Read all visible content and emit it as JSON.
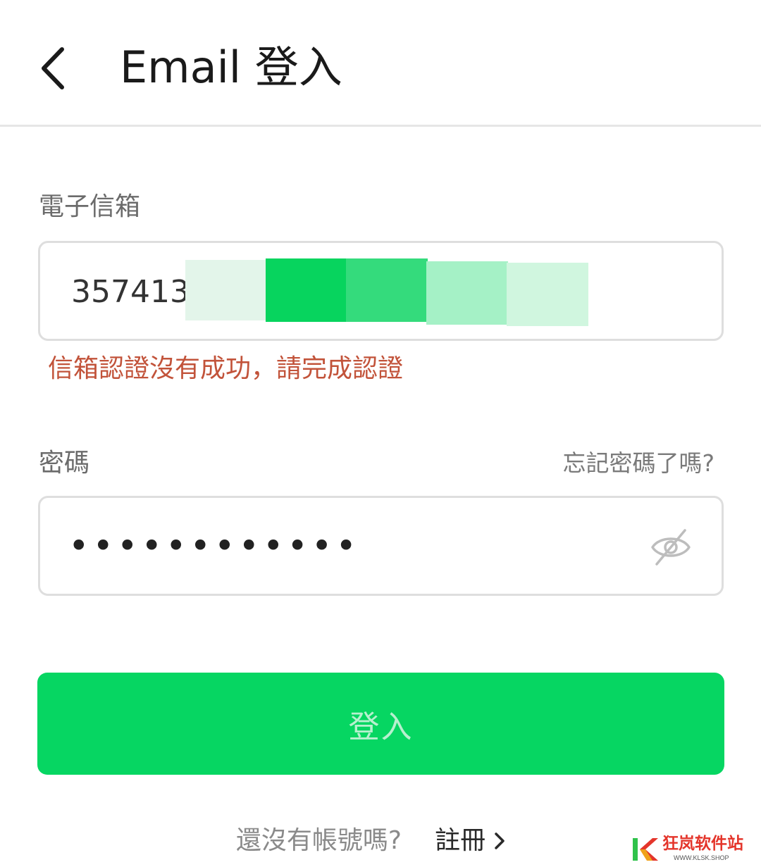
{
  "header": {
    "title": "Email 登入",
    "back_icon": "chevron-left-icon"
  },
  "email": {
    "label": "電子信箱",
    "value": "3574137",
    "error": "信箱認證沒有成功，請完成認證",
    "redaction_colors": [
      "#e3f5ea",
      "#07d45e",
      "#34db7c",
      "#a5f1c6",
      "#d0f6df"
    ]
  },
  "password": {
    "label": "密碼",
    "forgot_link": "忘記密碼了嗎?",
    "masked_value": "••••••••••••",
    "toggle_icon": "eye-off-icon"
  },
  "login_button": {
    "label": "登入",
    "color": "#06d662"
  },
  "footer": {
    "prompt": "還沒有帳號嗎?",
    "register_label": "註冊",
    "register_icon": "chevron-right-icon"
  },
  "watermark": {
    "text": "狂岚软件站",
    "sub": "WWW.KLSK.SHOP"
  },
  "colors": {
    "accent": "#06d662",
    "error": "#c2533a",
    "border": "#dedede",
    "label": "#6b6b6b"
  }
}
